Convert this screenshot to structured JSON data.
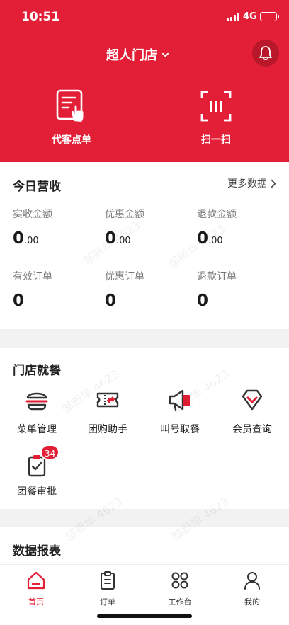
{
  "status_bar": {
    "time": "10:51",
    "network": "4G"
  },
  "header": {
    "store_name": "超人门店",
    "quick_actions": [
      {
        "label": "代客点单",
        "icon": "order-for-customer-icon"
      },
      {
        "label": "扫一扫",
        "icon": "scan-icon"
      }
    ]
  },
  "revenue": {
    "title": "今日营收",
    "more_label": "更多数据",
    "stats": [
      {
        "label": "实收金额",
        "int": "0",
        "dec": ".00"
      },
      {
        "label": "优惠金额",
        "int": "0",
        "dec": ".00"
      },
      {
        "label": "退款金额",
        "int": "0",
        "dec": ".00"
      },
      {
        "label": "有效订单",
        "int": "0",
        "dec": ""
      },
      {
        "label": "优惠订单",
        "int": "0",
        "dec": ""
      },
      {
        "label": "退款订单",
        "int": "0",
        "dec": ""
      }
    ]
  },
  "dine": {
    "title": "门店就餐",
    "items": [
      {
        "label": "菜单管理",
        "icon": "burger-icon"
      },
      {
        "label": "团购助手",
        "icon": "coupon-icon"
      },
      {
        "label": "叫号取餐",
        "icon": "megaphone-icon"
      },
      {
        "label": "会员查询",
        "icon": "diamond-icon"
      },
      {
        "label": "团餐审批",
        "icon": "clipboard-check-icon",
        "badge": "34"
      }
    ]
  },
  "reports": {
    "title": "数据报表"
  },
  "tabbar": {
    "tabs": [
      {
        "label": "首页",
        "icon": "home-icon",
        "active": true
      },
      {
        "label": "订单",
        "icon": "clipboard-icon"
      },
      {
        "label": "工作台",
        "icon": "grid-icon"
      },
      {
        "label": "我的",
        "icon": "user-icon"
      }
    ]
  },
  "watermark": "邹新华 4623",
  "colors": {
    "brand": "#e21f36",
    "brand_dark": "#b9172a"
  }
}
